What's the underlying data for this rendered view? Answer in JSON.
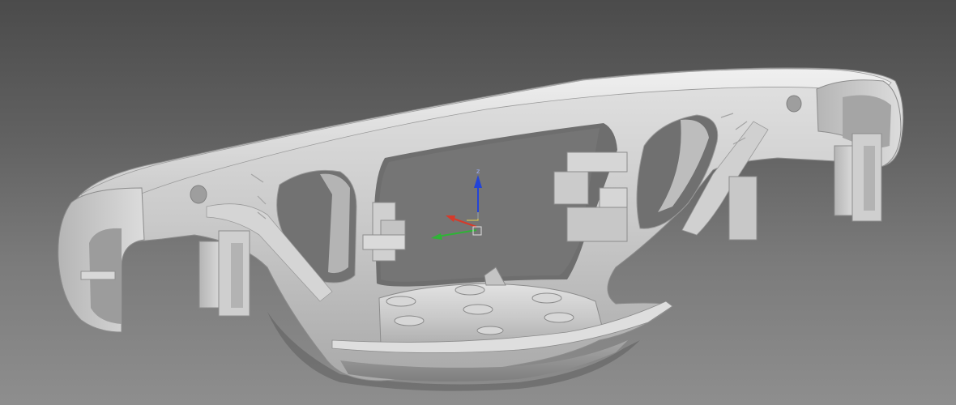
{
  "viewport": {
    "background_top": "#4b4b4b",
    "background_bottom": "#8e8e8e",
    "model": {
      "icon": "cast-steel-bogie-side-frame",
      "base_color": "#c9c9c9",
      "shadow_color": "#8a8a8a",
      "highlight_color": "#e6e6e6"
    },
    "gizmo": {
      "icon": "transform-gizmo-icon",
      "z_axis_label": "z",
      "x_axis_color": "#d63a2a",
      "y_axis_color": "#2fb336",
      "z_axis_color": "#2344d8"
    }
  }
}
